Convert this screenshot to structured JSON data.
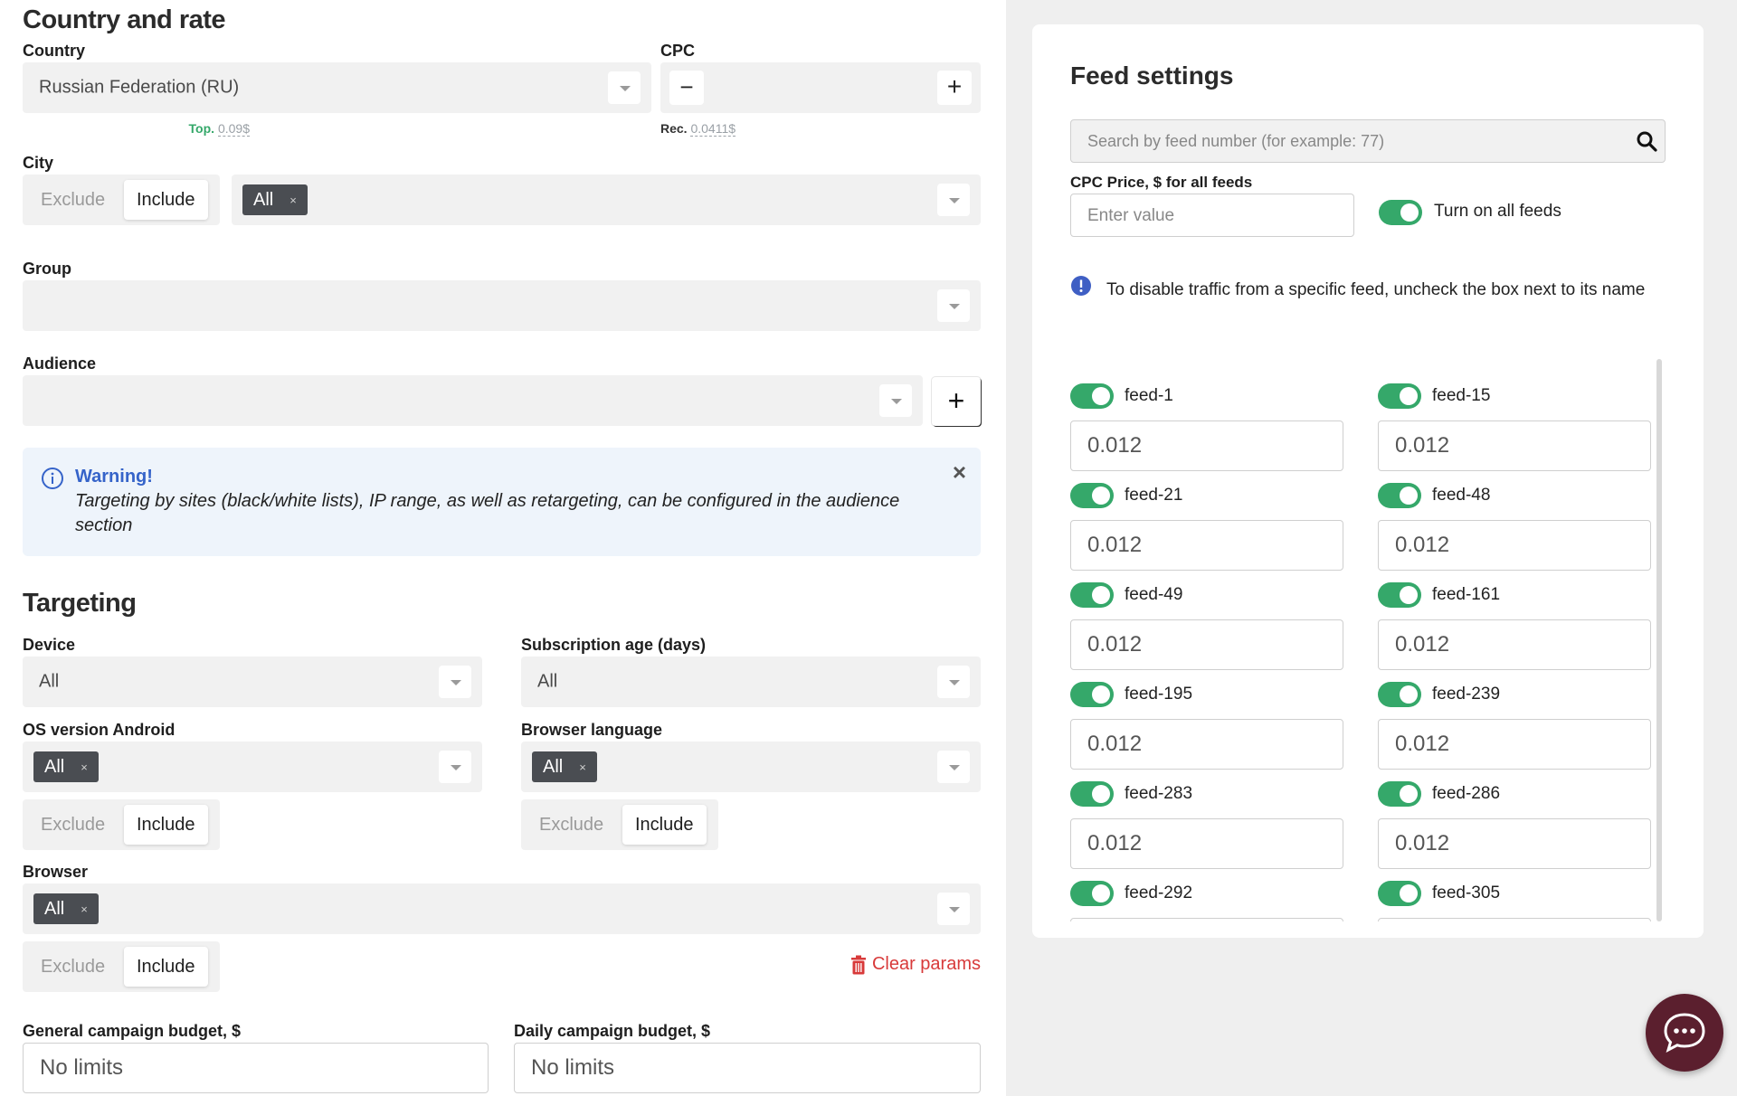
{
  "left": {
    "country_rate": {
      "title": "Country and rate",
      "country_label": "Country",
      "country_value": "Russian Federation (RU)",
      "cpc_label": "CPC",
      "cpc_minus": "−",
      "cpc_plus": "+",
      "rec_label": "Rec.",
      "rec_value": "0.0411$",
      "top_label": "Top.",
      "top_value": "0.09$"
    },
    "city": {
      "label": "City",
      "exclude": "Exclude",
      "include": "Include",
      "chip": "All",
      "chip_x": "×"
    },
    "group": {
      "label": "Group"
    },
    "audience": {
      "label": "Audience",
      "add": "+"
    },
    "warning": {
      "title": "Warning!",
      "text": "Targeting by sites (black/white lists), IP range, as well as retargeting, can be configured in the audience section",
      "close": "×"
    },
    "targeting": {
      "title": "Targeting",
      "device_label": "Device",
      "device_value": "All",
      "sub_age_label": "Subscription age (days)",
      "sub_age_value": "All",
      "os_label": "OS version Android",
      "os_chip": "All",
      "browser_lang_label": "Browser language",
      "browser_lang_chip": "All",
      "browser_label": "Browser",
      "browser_chip": "All",
      "chip_x": "×",
      "exclude": "Exclude",
      "include": "Include",
      "clear_params": "Clear params"
    },
    "budget": {
      "general_label": "General campaign budget, $",
      "general_placeholder": "No limits",
      "daily_label": "Daily campaign budget, $",
      "daily_placeholder": "No limits"
    }
  },
  "feed_settings": {
    "title": "Feed settings",
    "search_placeholder": "Search by feed number (for example: 77)",
    "cpc_all_label": "CPC Price, $ for all feeds",
    "cpc_all_placeholder": "Enter value",
    "turn_on_all": "Turn on all feeds",
    "info_text": "To disable traffic from a specific feed, uncheck the box next to its name",
    "feeds": [
      {
        "name": "feed-1",
        "value": "0.012",
        "on": true
      },
      {
        "name": "feed-15",
        "value": "0.012",
        "on": true
      },
      {
        "name": "feed-21",
        "value": "0.012",
        "on": true
      },
      {
        "name": "feed-48",
        "value": "0.012",
        "on": true
      },
      {
        "name": "feed-49",
        "value": "0.012",
        "on": true
      },
      {
        "name": "feed-161",
        "value": "0.012",
        "on": true
      },
      {
        "name": "feed-195",
        "value": "0.012",
        "on": true
      },
      {
        "name": "feed-239",
        "value": "0.012",
        "on": true
      },
      {
        "name": "feed-283",
        "value": "0.012",
        "on": true
      },
      {
        "name": "feed-286",
        "value": "0.012",
        "on": true
      },
      {
        "name": "feed-292",
        "value": "",
        "on": true
      },
      {
        "name": "feed-305",
        "value": "",
        "on": true
      }
    ]
  },
  "colors": {
    "toggle_on": "#35a86a",
    "warning_title": "#3563c9",
    "clear_params": "#d83a3a",
    "chat_button": "#5b1f2e"
  }
}
